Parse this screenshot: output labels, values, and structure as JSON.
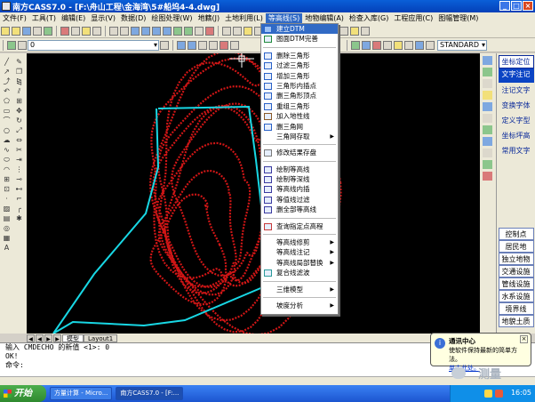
{
  "window": {
    "title": "南方CASS7.0 - [F:\\舟山工程\\金海湾\\5#船坞4-4.dwg]",
    "buttons": [
      "minimize",
      "maximize",
      "close"
    ]
  },
  "menubar": {
    "items": [
      "文件(F)",
      "工具(T)",
      "编辑(E)",
      "显示(V)",
      "数据(D)",
      "绘图处理(W)",
      "地籍(J)",
      "土地利用(L)",
      "等高线(S)",
      "地物编辑(A)",
      "检查入库(G)",
      "工程应用(C)",
      "图幅管理(M)"
    ],
    "active_index": 8
  },
  "toolbar": {
    "layer_value": "0",
    "style_value": "STANDARD"
  },
  "context_menu": {
    "groups": [
      [
        {
          "label": "建立DTM",
          "icon": "triangle-icon",
          "highlighted": true
        },
        {
          "label": "图面DTM完善",
          "icon": "globe-icon"
        }
      ],
      [
        {
          "label": "删除三角形",
          "icon": "triangle-icon"
        },
        {
          "label": "过滤三角形",
          "icon": "triangle-icon"
        },
        {
          "label": "增加三角形",
          "icon": "triangle-icon"
        },
        {
          "label": "三角形内插点",
          "icon": "triangle-icon"
        },
        {
          "label": "删三角形顶点",
          "icon": "triangle-icon"
        },
        {
          "label": "重组三角形",
          "icon": "triangle-icon"
        },
        {
          "label": "加入地性线",
          "icon": "pen-icon"
        },
        {
          "label": "删三角网",
          "icon": "mesh-icon"
        },
        {
          "label": "三角网存取",
          "icon": "",
          "submenu": true
        }
      ],
      [
        {
          "label": "修改结果存盘",
          "icon": "save-icon"
        }
      ],
      [
        {
          "label": "绘制等高线",
          "icon": "contour-icon"
        },
        {
          "label": "绘制等深线",
          "icon": "contour-icon"
        },
        {
          "label": "等高线内插",
          "icon": "contour-icon"
        },
        {
          "label": "等值线过滤",
          "icon": "contour-icon"
        },
        {
          "label": "删全部等高线",
          "icon": "contour-icon"
        }
      ],
      [
        {
          "label": "查询指定点高程",
          "icon": "query-icon"
        }
      ],
      [
        {
          "label": "等高线修剪",
          "icon": "",
          "submenu": true
        },
        {
          "label": "等高线注记",
          "icon": "",
          "submenu": true
        },
        {
          "label": "等高线局部替换",
          "icon": "",
          "submenu": true
        },
        {
          "label": "复合线滤波",
          "icon": "filter-icon"
        }
      ],
      [
        {
          "label": "三维模型",
          "icon": "",
          "submenu": true
        }
      ],
      [
        {
          "label": "坡度分析",
          "icon": "",
          "submenu": true
        }
      ]
    ]
  },
  "cass_panel": {
    "top_buttons": [
      "坐标定位",
      "文字注记",
      "注记文字",
      "变换字体",
      "定义字型",
      "坐标坪高",
      "常用文字"
    ],
    "bottom_buttons": [
      "控制点",
      "居民地",
      "独立地物",
      "交通设施",
      "管线设施",
      "水系设施",
      "境界线",
      "地貌土质"
    ]
  },
  "layout_tabs": [
    "模型",
    "Layout1"
  ],
  "command": {
    "lines": [
      "输入 CMDECHO 的新值 <1>: 0",
      "OK!",
      "命令:"
    ]
  },
  "balloon": {
    "title": "通讯中心",
    "text": "使软件保持最新的简单方法。",
    "link": "单击此处。"
  },
  "taskbar": {
    "start_label": "开始",
    "items": [
      "方量计算 - Micro...",
      "南方CASS7.0 - [F:..."
    ],
    "active_index": 1,
    "clock": "16:05"
  },
  "watermark": "测量",
  "colors": {
    "contour": "#d01616",
    "boundary": "#18d7e4",
    "menu_highlight": "#316ac5",
    "titlebar": "#0a5fd8"
  }
}
